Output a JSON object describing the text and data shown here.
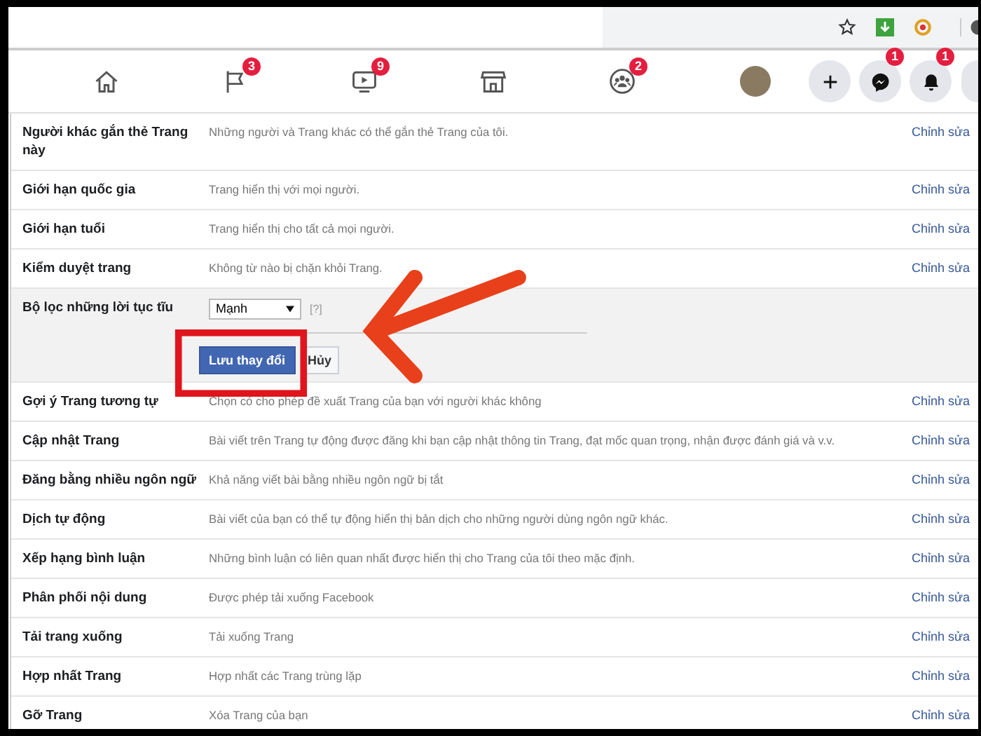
{
  "nav": {
    "items": [
      {
        "kind": "home"
      },
      {
        "kind": "flag",
        "badge": "3"
      },
      {
        "kind": "video",
        "badge": "9"
      },
      {
        "kind": "store"
      },
      {
        "kind": "groups",
        "badge": "2"
      }
    ],
    "actions": [
      {
        "kind": "avatar"
      },
      {
        "kind": "plus"
      },
      {
        "kind": "messenger",
        "badge": "1"
      },
      {
        "kind": "bell",
        "badge": "1"
      }
    ]
  },
  "settings": [
    {
      "kind": "row",
      "label": "Người khác gắn thẻ Trang này",
      "value": "Những người và Trang khác có thể gắn thẻ Trang của tôi.",
      "action": "Chỉnh sửa"
    },
    {
      "kind": "row",
      "label": "Giới hạn quốc gia",
      "value": "Trang hiển thị với mọi người.",
      "action": "Chỉnh sửa"
    },
    {
      "kind": "row",
      "label": "Giới hạn tuổi",
      "value": "Trang hiển thị cho tất cả mọi người.",
      "action": "Chỉnh sửa"
    },
    {
      "kind": "row",
      "label": "Kiểm duyệt trang",
      "value": "Không từ nào bị chặn khỏi Trang.",
      "action": "Chỉnh sửa"
    },
    {
      "kind": "editor",
      "label": "Bộ lọc những lời tục tĩu",
      "select": "Mạnh",
      "help": "[?]",
      "save": "Lưu thay đổi",
      "cancel": "Hủy"
    },
    {
      "kind": "row",
      "label": "Gợi ý Trang tương tự",
      "value": "Chọn có cho phép đề xuất Trang của bạn với người khác không",
      "action": "Chỉnh sửa"
    },
    {
      "kind": "row",
      "label": "Cập nhật Trang",
      "value": "Bài viết trên Trang tự động được đăng khi bạn cập nhật thông tin Trang, đạt mốc quan trọng, nhận được đánh giá và v.v.",
      "action": "Chỉnh sửa"
    },
    {
      "kind": "row",
      "label": "Đăng bằng nhiều ngôn ngữ",
      "value": "Khả năng viết bài bằng nhiều ngôn ngữ bị tắt",
      "action": "Chỉnh sửa"
    },
    {
      "kind": "row",
      "label": "Dịch tự động",
      "value": "Bài viết của bạn có thể tự động hiển thị bản dịch cho những người dùng ngôn ngữ khác.",
      "action": "Chỉnh sửa"
    },
    {
      "kind": "row",
      "label": "Xếp hạng bình luận",
      "value": "Những bình luận có liên quan nhất được hiển thị cho Trang của tôi theo mặc định.",
      "action": "Chỉnh sửa"
    },
    {
      "kind": "row",
      "label": "Phân phối nội dung",
      "value": "Được phép tải xuống Facebook",
      "action": "Chỉnh sửa"
    },
    {
      "kind": "row",
      "label": "Tải trang xuống",
      "value": "Tải xuống Trang",
      "action": "Chỉnh sửa"
    },
    {
      "kind": "row",
      "label": "Hợp nhất Trang",
      "value": "Hợp nhất các Trang trùng lặp",
      "action": "Chỉnh sửa"
    },
    {
      "kind": "row",
      "label": "Gỡ Trang",
      "value": "Xóa Trang của bạn",
      "action": "Chỉnh sửa"
    }
  ]
}
